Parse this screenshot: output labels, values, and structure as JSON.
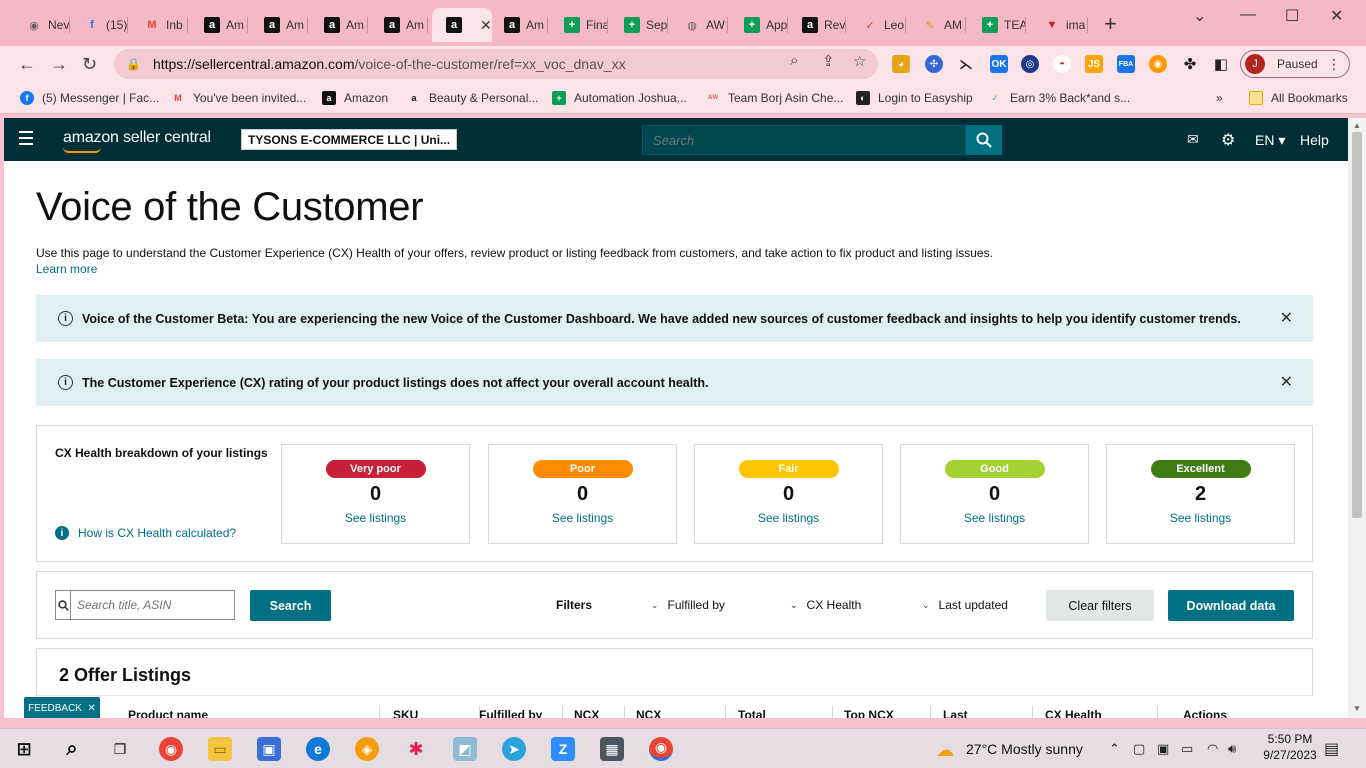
{
  "browser": {
    "tabs": [
      {
        "label": "Nev",
        "icon": "chrome-icon",
        "color": "#5f6368",
        "glyph": "◉"
      },
      {
        "label": "(15)",
        "icon": "facebook-icon",
        "color": "#1877f2",
        "glyph": "f"
      },
      {
        "label": "Inb",
        "icon": "gmail-icon",
        "color": "#ea4335",
        "glyph": "M"
      },
      {
        "label": "Am",
        "icon": "amazon-icon",
        "color": "#111111",
        "glyph": "a"
      },
      {
        "label": "Am",
        "icon": "amazon-icon",
        "color": "#111111",
        "glyph": "a"
      },
      {
        "label": "Am",
        "icon": "amazon-icon",
        "color": "#111111",
        "glyph": "a"
      },
      {
        "label": "Am",
        "icon": "amazon-icon",
        "color": "#111111",
        "glyph": "a"
      },
      {
        "label": "",
        "icon": "amazon-icon",
        "color": "#111111",
        "glyph": "a",
        "active": true
      },
      {
        "label": "Am",
        "icon": "amazon-icon",
        "color": "#111111",
        "glyph": "a"
      },
      {
        "label": "Fina",
        "icon": "sheets-icon",
        "color": "#0f9d58",
        "glyph": "+"
      },
      {
        "label": "Sep",
        "icon": "sheets-icon",
        "color": "#0f9d58",
        "glyph": "+"
      },
      {
        "label": "AW",
        "icon": "globe-icon",
        "color": "#5f6368",
        "glyph": "◍"
      },
      {
        "label": "App",
        "icon": "sheets-icon",
        "color": "#0f9d58",
        "glyph": "+"
      },
      {
        "label": "Rev",
        "icon": "amazon-icon",
        "color": "#111111",
        "glyph": "a"
      },
      {
        "label": "Leo",
        "icon": "leo-icon",
        "color": "#d93025",
        "glyph": "✓"
      },
      {
        "label": "AM",
        "icon": "pencil-icon",
        "color": "#f29900",
        "glyph": "✎"
      },
      {
        "label": "TEA",
        "icon": "sheets-icon",
        "color": "#0f9d58",
        "glyph": "+"
      },
      {
        "label": "ima",
        "icon": "triangle-icon",
        "color": "#c5221f",
        "glyph": "▼"
      }
    ],
    "url_host": "https://sellercentral.amazon.com",
    "url_path": "/voice-of-the-customer/ref=xx_voc_dnav_xx",
    "profile_initial": "J",
    "profile_status": "Paused",
    "bookmarks": [
      {
        "label": "(5) Messenger | Fac...",
        "icon": "facebook-icon",
        "color": "#1877f2",
        "glyph": "f"
      },
      {
        "label": "You've been invited...",
        "icon": "gmail-icon",
        "color": "#ea4335",
        "glyph": "M"
      },
      {
        "label": "Amazon",
        "icon": "amazon-icon",
        "color": "#111111",
        "glyph": "a"
      },
      {
        "label": "Beauty & Personal...",
        "icon": "amazon-a-icon",
        "color": "#111111",
        "glyph": "a"
      },
      {
        "label": "Automation Joshua...",
        "icon": "sheets-icon",
        "color": "#0f9d58",
        "glyph": "+"
      },
      {
        "label": "Team Borj Asin Che...",
        "icon": "aw-icon",
        "color": "#e06666",
        "glyph": "ᴬᵂ"
      },
      {
        "label": "Login to Easyship",
        "icon": "easyship-icon",
        "color": "#222222",
        "glyph": "◐"
      },
      {
        "label": "Earn 3% Back*and s...",
        "icon": "cashback-icon",
        "color": "#4caf50",
        "glyph": "✓"
      }
    ],
    "all_bookmarks": "All Bookmarks"
  },
  "header": {
    "logo": "amazon seller central",
    "merchant": "TYSONS E-COMMERCE LLC | Uni...",
    "search_placeholder": "Search",
    "language": "EN",
    "help": "Help"
  },
  "page": {
    "title": "Voice of the Customer",
    "description": "Use this page to understand the Customer Experience (CX) Health of your offers, review product or listing feedback from customers, and take action to fix product and listing issues.",
    "learn_more": "Learn more",
    "alert_beta": "Voice of the Customer Beta: You are experiencing the new Voice of the Customer Dashboard. We have added new sources of customer feedback and insights to help you identify customer trends.",
    "alert_rating": "The Customer Experience (CX) rating of your product listings does not affect your overall account health."
  },
  "cx": {
    "label": "CX Health breakdown of your listings",
    "how_link": "How is CX Health calculated?",
    "see_listings": "See listings",
    "cards": [
      {
        "name": "Very poor",
        "count": "0",
        "color": "#c7213a"
      },
      {
        "name": "Poor",
        "count": "0",
        "color": "#ff8c00"
      },
      {
        "name": "Fair",
        "count": "0",
        "color": "#ffc400"
      },
      {
        "name": "Good",
        "count": "0",
        "color": "#a4d233"
      },
      {
        "name": "Excellent",
        "count": "2",
        "color": "#3f7c14"
      }
    ]
  },
  "filters": {
    "search_placeholder": "Search title, ASIN",
    "search_button": "Search",
    "label": "Filters",
    "fulfilled_by": "Fulfilled by",
    "cx_health": "CX Health",
    "last_updated": "Last updated",
    "clear": "Clear filters",
    "download": "Download data"
  },
  "listings": {
    "title": "2 Offer Listings",
    "columns": [
      "Product name",
      "SKU",
      "Fulfilled by",
      "NCX",
      "NCX",
      "Total",
      "Top NCX",
      "Last",
      "CX Health",
      "Actions"
    ]
  },
  "feedback": "FEEDBACK",
  "taskbar": {
    "weather": "27°C  Mostly sunny",
    "time": "5:50 PM",
    "date": "9/27/2023"
  }
}
